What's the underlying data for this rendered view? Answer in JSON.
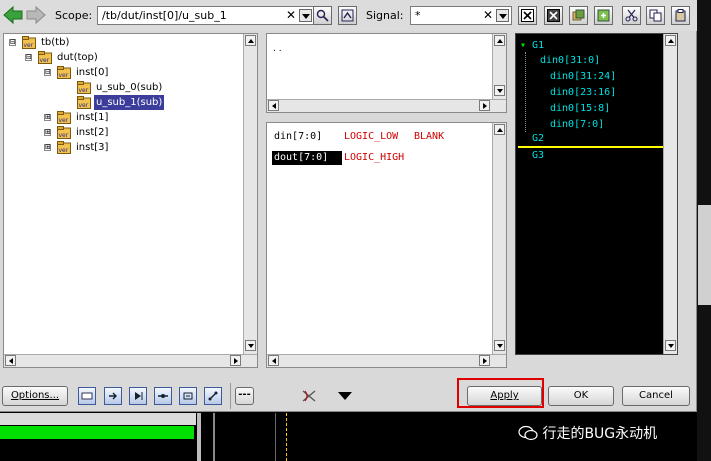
{
  "toolbar": {
    "scope_label": "Scope:",
    "scope_value": "/tb/dut/inst[0]/u_sub_1",
    "signal_label": "Signal:",
    "signal_value": "*"
  },
  "tree": {
    "items": [
      {
        "label": "tb(tb)",
        "expander": "⊟"
      },
      {
        "label": "dut(top)",
        "expander": "⊟"
      },
      {
        "label": "inst[0]",
        "expander": "⊟"
      },
      {
        "label": "u_sub_0(sub)",
        "expander": ""
      },
      {
        "label": "u_sub_1(sub)",
        "expander": ""
      },
      {
        "label": "inst[1]",
        "expander": "⊞"
      },
      {
        "label": "inst[2]",
        "expander": "⊞"
      },
      {
        "label": "inst[3]",
        "expander": "⊞"
      }
    ],
    "icon_text": "ver"
  },
  "middle_top": {
    "text": ". ."
  },
  "signals": [
    {
      "name": "din[7:0]",
      "value": "LOGIC_LOW",
      "value2": "BLANK"
    },
    {
      "name": "dout[7:0]",
      "value": "LOGIC_HIGH",
      "value2": ""
    }
  ],
  "wave": {
    "group1": "G1",
    "group2": "G2",
    "group3": "G3",
    "items": [
      "din0[31:0]",
      "din0[31:24]",
      "din0[23:16]",
      "din0[15:8]",
      "din0[7:0]"
    ]
  },
  "buttons": {
    "options": "Options...",
    "dots": "---",
    "apply": "Apply",
    "ok": "OK",
    "cancel": "Cancel"
  },
  "watermark": "行走的BUG永动机",
  "colors": {
    "selection": "#3c3c9a",
    "signal_value": "#d00000",
    "wave_text": "#00e0e0",
    "wave_marker": "#ffff00",
    "highlight_box": "#e00000",
    "green_bar": "#00e000"
  }
}
